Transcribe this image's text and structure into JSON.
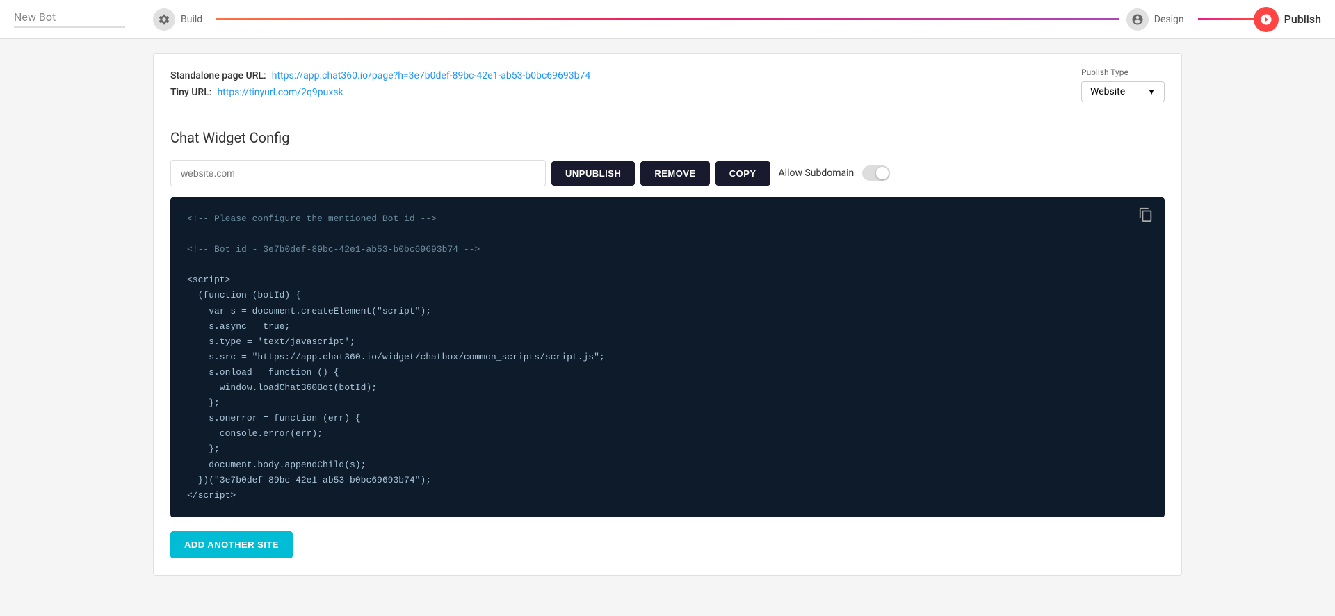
{
  "header": {
    "new_bot_label": "New Bot",
    "build_label": "Build",
    "design_label": "Design",
    "publish_label": "Publish"
  },
  "content": {
    "standalone_url_label": "Standalone page URL:",
    "standalone_url_value": "https://app.chat360.io/page?h=3e7b0def-89bc-42e1-ab53-b0bc69693b74",
    "tiny_url_label": "Tiny URL:",
    "tiny_url_value": "https://tinyurl.com/2q9puxsk",
    "publish_type_label": "Publish Type",
    "publish_type_value": "Website",
    "section_title": "Chat Widget Config",
    "website_input_placeholder": "website.com",
    "btn_unpublish": "UNPUBLISH",
    "btn_remove": "REMOVE",
    "btn_copy": "COPY",
    "allow_subdomain_label": "Allow Subdomain",
    "code_lines": [
      "<!-- Please configure the mentioned Bot id -->",
      "",
      "<!-- Bot id - 3e7b0def-89bc-42e1-ab53-b0bc69693b74 -->",
      "",
      "<script>",
      "  (function (botId) {",
      "    var s = document.createElement(\"script\");",
      "    s.async = true;",
      "    s.type = 'text/javascript';",
      "    s.src = \"https://app.chat360.io/widget/chatbox/common_scripts/script.js\";",
      "    s.onload = function () {",
      "      window.loadChat360Bot(botId);",
      "    };",
      "    s.onerror = function (err) {",
      "      console.error(err);",
      "    };",
      "    document.body.appendChild(s);",
      "  })(\"3e7b0def-89bc-42e1-ab53-b0bc69693b74\");",
      "</script>"
    ],
    "btn_add_site": "ADD ANOTHER SITE"
  }
}
